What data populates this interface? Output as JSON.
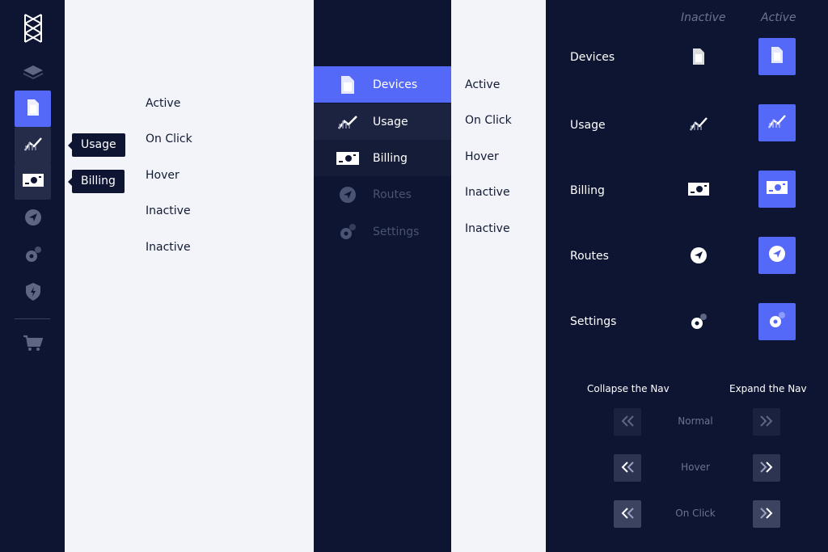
{
  "rail": {
    "icons": [
      "brand-logo-icon",
      "layers-icon",
      "devices-icon",
      "usage-icon",
      "billing-icon",
      "routes-icon",
      "settings-icon",
      "security-icon",
      "cart-icon"
    ]
  },
  "tooltips": {
    "usage": "Usage",
    "billing": "Billing"
  },
  "state_labels": [
    "Active",
    "On Click",
    "Hover",
    "Inactive",
    "Inactive"
  ],
  "nav": {
    "items": [
      {
        "label": "Devices",
        "state": "active"
      },
      {
        "label": "Usage",
        "state": "click"
      },
      {
        "label": "Billing",
        "state": "hover"
      },
      {
        "label": "Routes",
        "state": "inactive"
      },
      {
        "label": "Settings",
        "state": "inactive"
      }
    ]
  },
  "nav_state_labels": [
    "Active",
    "On Click",
    "Hover",
    "Inactive",
    "Inactive"
  ],
  "panel": {
    "col_inactive": "Inactive",
    "col_active": "Active",
    "rows": [
      "Devices",
      "Usage",
      "Billing",
      "Routes",
      "Settings"
    ],
    "collapse_label": "Collapse the Nav",
    "expand_label": "Expand the Nav",
    "chevron_states": [
      "Normal",
      "Hover",
      "On Click"
    ]
  },
  "colors": {
    "accent": "#5469f8",
    "navy": "#0e1532",
    "light": "#f3f4fa"
  }
}
